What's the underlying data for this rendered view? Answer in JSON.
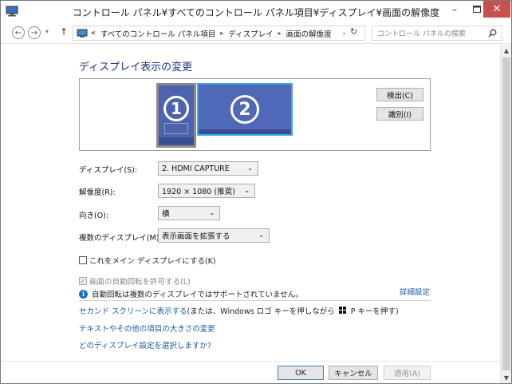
{
  "window": {
    "title": "コントロール パネル¥すべてのコントロール パネル項目¥ディスプレイ¥画面の解像度",
    "minimize": "–",
    "close": "✕"
  },
  "address": {
    "prefix": "«",
    "crumbs": [
      "すべてのコントロール パネル項目",
      "ディスプレイ",
      "画面の解像度"
    ],
    "search_placeholder": "コントロール パネルの検索"
  },
  "page": {
    "title": "ディスプレイ表示の変更",
    "monitors": [
      {
        "number": "1"
      },
      {
        "number": "2"
      }
    ],
    "detect_button": "検出(C)",
    "identify_button": "識別(I)"
  },
  "settings": {
    "display_label": "ディスプレイ(S):",
    "display_value": "2. HDMI CAPTURE",
    "resolution_label": "解像度(R):",
    "resolution_value": "1920 × 1080 (推奨)",
    "orientation_label": "向き(O):",
    "orientation_value": "横",
    "multiple_label": "複数のディスプレイ(M):",
    "multiple_value": "表示画面を拡張する",
    "main_display_checkbox": "これをメイン ディスプレイにする(K)",
    "auto_rotate_checkbox": "画面の自動回転を許可する(L)",
    "auto_rotate_info": "自動回転は複数のディスプレイではサポートされていません。",
    "advanced_link": "詳細設定"
  },
  "links": {
    "second_screen_link": "セカンド スクリーンに表示する",
    "second_screen_note_a": " (または、Windows ロゴ キーを押しながら ",
    "second_screen_note_b": " P キーを押す)",
    "text_size_link": "テキストやその他の項目の大きさの変更",
    "which_display_link": "どのディスプレイ設定を選択しますか?"
  },
  "footer": {
    "ok": "OK",
    "cancel": "キャンセル",
    "apply": "適用(A)"
  },
  "colors": {
    "title_blue": "#1e3287",
    "link_blue": "#1e5aa0",
    "monitor_blue": "#4d63ae",
    "close_red": "#c75050"
  }
}
